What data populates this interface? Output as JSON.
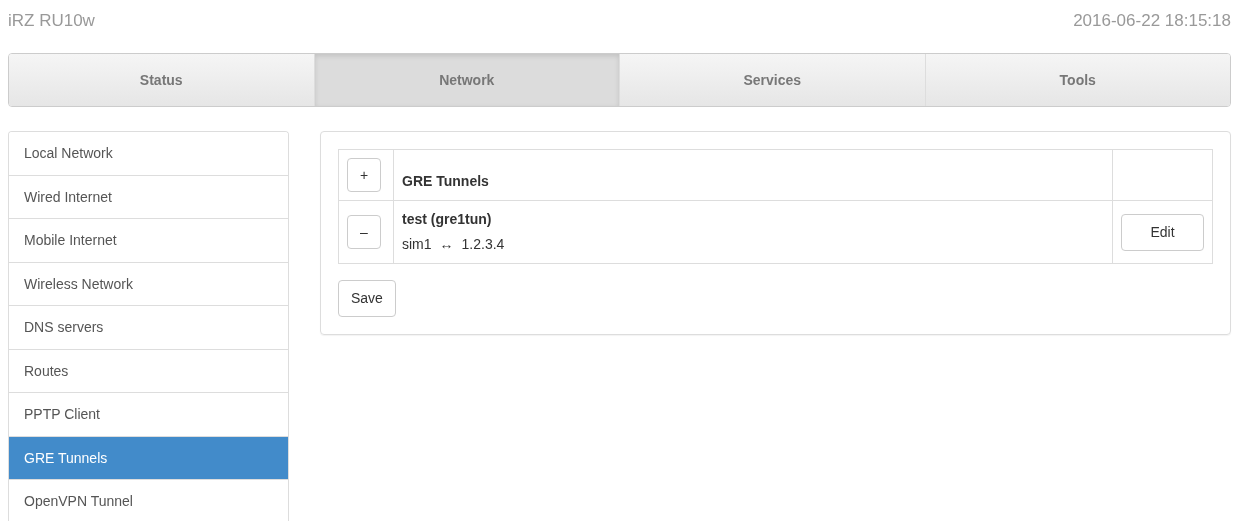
{
  "header": {
    "brand": "iRZ RU10w",
    "datetime": "2016-06-22 18:15:18"
  },
  "tabs": [
    {
      "label": "Status",
      "selected": false
    },
    {
      "label": "Network",
      "selected": true
    },
    {
      "label": "Services",
      "selected": false
    },
    {
      "label": "Tools",
      "selected": false
    }
  ],
  "sidebar": {
    "items": [
      {
        "label": "Local Network",
        "selected": false
      },
      {
        "label": "Wired Internet",
        "selected": false
      },
      {
        "label": "Mobile Internet",
        "selected": false
      },
      {
        "label": "Wireless Network",
        "selected": false
      },
      {
        "label": "DNS servers",
        "selected": false
      },
      {
        "label": "Routes",
        "selected": false
      },
      {
        "label": "PPTP Client",
        "selected": false
      },
      {
        "label": "GRE Tunnels",
        "selected": true
      },
      {
        "label": "OpenVPN Tunnel",
        "selected": false
      }
    ]
  },
  "table": {
    "add_button": "+",
    "title": "GRE Tunnels",
    "rows": [
      {
        "remove_button": "–",
        "name": "test (gre1tun)",
        "endpoint_local": "sim1",
        "arrow": "↔",
        "endpoint_remote": "1.2.3.4",
        "edit_button": "Edit"
      }
    ]
  },
  "save_button": "Save"
}
